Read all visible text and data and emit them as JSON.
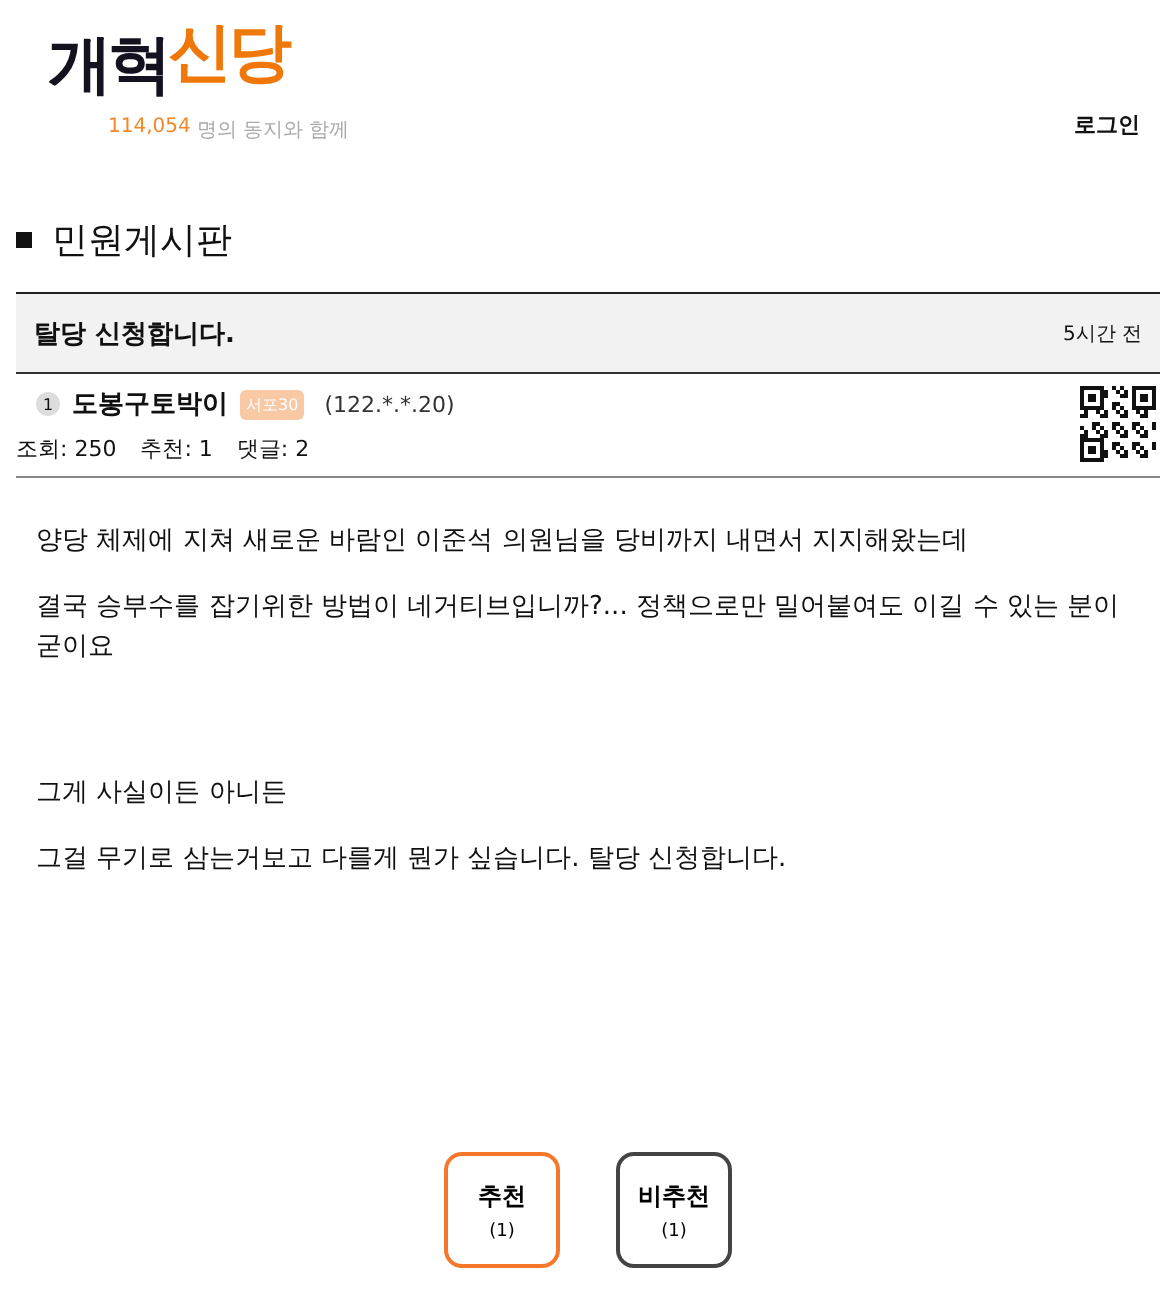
{
  "logo": {
    "part_1": "개혁",
    "part_2": "신당"
  },
  "tagline": {
    "count": "114,054",
    "text": "명의 동지와 함께"
  },
  "login": "로그인",
  "board_title": "민원게시판",
  "post": {
    "title": "탈당 신청합니다.",
    "time": "5시간 전",
    "author": {
      "level": "1",
      "name": "도봉구토박이",
      "badge": "서포30",
      "ip": "(122.*.*.20)"
    },
    "stats": [
      "조회: 250",
      "추천: 1",
      "댓글: 2"
    ],
    "body": [
      {
        "kind": "plain",
        "text": "양당 체제에 지쳐 새로운 바람인 이준석 의원님을 당비까지 내면서 지지해왔는데"
      },
      {
        "kind": "plain",
        "text": "결국 승부수를 잡기위한 방법이 네거티브입니까?... 정책으로만 밀어붙여도 이길 수 있는 분이 굳이요"
      },
      {
        "kind": "spaced",
        "text": "그게 사실이든 아니든"
      },
      {
        "kind": "plain",
        "text": "그걸 무기로 삼는거보고 다를게 뭔가 싶습니다. 탈당 신청합니다."
      }
    ]
  },
  "votes": [
    {
      "kind": "up",
      "label": "추천",
      "count": "(1)"
    },
    {
      "kind": "down",
      "label": "비추천",
      "count": "(1)"
    }
  ]
}
